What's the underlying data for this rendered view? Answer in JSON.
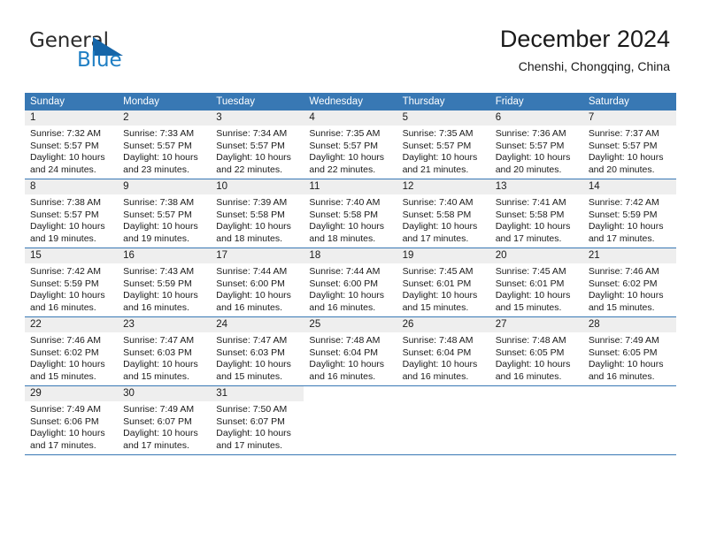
{
  "brand": {
    "name_top": "General",
    "name_bottom": "Blue",
    "accent_color": "#1f7fc4",
    "triangle_color": "#1565a8"
  },
  "header": {
    "title": "December 2024",
    "location": "Chenshi, Chongqing, China"
  },
  "calendar": {
    "header_bg": "#3878b4",
    "day_strip_bg": "#eeeeee",
    "weekdays": [
      "Sunday",
      "Monday",
      "Tuesday",
      "Wednesday",
      "Thursday",
      "Friday",
      "Saturday"
    ],
    "weeks": [
      [
        {
          "day": "1",
          "sunrise": "Sunrise: 7:32 AM",
          "sunset": "Sunset: 5:57 PM",
          "daylight_1": "Daylight: 10 hours",
          "daylight_2": "and 24 minutes."
        },
        {
          "day": "2",
          "sunrise": "Sunrise: 7:33 AM",
          "sunset": "Sunset: 5:57 PM",
          "daylight_1": "Daylight: 10 hours",
          "daylight_2": "and 23 minutes."
        },
        {
          "day": "3",
          "sunrise": "Sunrise: 7:34 AM",
          "sunset": "Sunset: 5:57 PM",
          "daylight_1": "Daylight: 10 hours",
          "daylight_2": "and 22 minutes."
        },
        {
          "day": "4",
          "sunrise": "Sunrise: 7:35 AM",
          "sunset": "Sunset: 5:57 PM",
          "daylight_1": "Daylight: 10 hours",
          "daylight_2": "and 22 minutes."
        },
        {
          "day": "5",
          "sunrise": "Sunrise: 7:35 AM",
          "sunset": "Sunset: 5:57 PM",
          "daylight_1": "Daylight: 10 hours",
          "daylight_2": "and 21 minutes."
        },
        {
          "day": "6",
          "sunrise": "Sunrise: 7:36 AM",
          "sunset": "Sunset: 5:57 PM",
          "daylight_1": "Daylight: 10 hours",
          "daylight_2": "and 20 minutes."
        },
        {
          "day": "7",
          "sunrise": "Sunrise: 7:37 AM",
          "sunset": "Sunset: 5:57 PM",
          "daylight_1": "Daylight: 10 hours",
          "daylight_2": "and 20 minutes."
        }
      ],
      [
        {
          "day": "8",
          "sunrise": "Sunrise: 7:38 AM",
          "sunset": "Sunset: 5:57 PM",
          "daylight_1": "Daylight: 10 hours",
          "daylight_2": "and 19 minutes."
        },
        {
          "day": "9",
          "sunrise": "Sunrise: 7:38 AM",
          "sunset": "Sunset: 5:57 PM",
          "daylight_1": "Daylight: 10 hours",
          "daylight_2": "and 19 minutes."
        },
        {
          "day": "10",
          "sunrise": "Sunrise: 7:39 AM",
          "sunset": "Sunset: 5:58 PM",
          "daylight_1": "Daylight: 10 hours",
          "daylight_2": "and 18 minutes."
        },
        {
          "day": "11",
          "sunrise": "Sunrise: 7:40 AM",
          "sunset": "Sunset: 5:58 PM",
          "daylight_1": "Daylight: 10 hours",
          "daylight_2": "and 18 minutes."
        },
        {
          "day": "12",
          "sunrise": "Sunrise: 7:40 AM",
          "sunset": "Sunset: 5:58 PM",
          "daylight_1": "Daylight: 10 hours",
          "daylight_2": "and 17 minutes."
        },
        {
          "day": "13",
          "sunrise": "Sunrise: 7:41 AM",
          "sunset": "Sunset: 5:58 PM",
          "daylight_1": "Daylight: 10 hours",
          "daylight_2": "and 17 minutes."
        },
        {
          "day": "14",
          "sunrise": "Sunrise: 7:42 AM",
          "sunset": "Sunset: 5:59 PM",
          "daylight_1": "Daylight: 10 hours",
          "daylight_2": "and 17 minutes."
        }
      ],
      [
        {
          "day": "15",
          "sunrise": "Sunrise: 7:42 AM",
          "sunset": "Sunset: 5:59 PM",
          "daylight_1": "Daylight: 10 hours",
          "daylight_2": "and 16 minutes."
        },
        {
          "day": "16",
          "sunrise": "Sunrise: 7:43 AM",
          "sunset": "Sunset: 5:59 PM",
          "daylight_1": "Daylight: 10 hours",
          "daylight_2": "and 16 minutes."
        },
        {
          "day": "17",
          "sunrise": "Sunrise: 7:44 AM",
          "sunset": "Sunset: 6:00 PM",
          "daylight_1": "Daylight: 10 hours",
          "daylight_2": "and 16 minutes."
        },
        {
          "day": "18",
          "sunrise": "Sunrise: 7:44 AM",
          "sunset": "Sunset: 6:00 PM",
          "daylight_1": "Daylight: 10 hours",
          "daylight_2": "and 16 minutes."
        },
        {
          "day": "19",
          "sunrise": "Sunrise: 7:45 AM",
          "sunset": "Sunset: 6:01 PM",
          "daylight_1": "Daylight: 10 hours",
          "daylight_2": "and 15 minutes."
        },
        {
          "day": "20",
          "sunrise": "Sunrise: 7:45 AM",
          "sunset": "Sunset: 6:01 PM",
          "daylight_1": "Daylight: 10 hours",
          "daylight_2": "and 15 minutes."
        },
        {
          "day": "21",
          "sunrise": "Sunrise: 7:46 AM",
          "sunset": "Sunset: 6:02 PM",
          "daylight_1": "Daylight: 10 hours",
          "daylight_2": "and 15 minutes."
        }
      ],
      [
        {
          "day": "22",
          "sunrise": "Sunrise: 7:46 AM",
          "sunset": "Sunset: 6:02 PM",
          "daylight_1": "Daylight: 10 hours",
          "daylight_2": "and 15 minutes."
        },
        {
          "day": "23",
          "sunrise": "Sunrise: 7:47 AM",
          "sunset": "Sunset: 6:03 PM",
          "daylight_1": "Daylight: 10 hours",
          "daylight_2": "and 15 minutes."
        },
        {
          "day": "24",
          "sunrise": "Sunrise: 7:47 AM",
          "sunset": "Sunset: 6:03 PM",
          "daylight_1": "Daylight: 10 hours",
          "daylight_2": "and 15 minutes."
        },
        {
          "day": "25",
          "sunrise": "Sunrise: 7:48 AM",
          "sunset": "Sunset: 6:04 PM",
          "daylight_1": "Daylight: 10 hours",
          "daylight_2": "and 16 minutes."
        },
        {
          "day": "26",
          "sunrise": "Sunrise: 7:48 AM",
          "sunset": "Sunset: 6:04 PM",
          "daylight_1": "Daylight: 10 hours",
          "daylight_2": "and 16 minutes."
        },
        {
          "day": "27",
          "sunrise": "Sunrise: 7:48 AM",
          "sunset": "Sunset: 6:05 PM",
          "daylight_1": "Daylight: 10 hours",
          "daylight_2": "and 16 minutes."
        },
        {
          "day": "28",
          "sunrise": "Sunrise: 7:49 AM",
          "sunset": "Sunset: 6:05 PM",
          "daylight_1": "Daylight: 10 hours",
          "daylight_2": "and 16 minutes."
        }
      ],
      [
        {
          "day": "29",
          "sunrise": "Sunrise: 7:49 AM",
          "sunset": "Sunset: 6:06 PM",
          "daylight_1": "Daylight: 10 hours",
          "daylight_2": "and 17 minutes."
        },
        {
          "day": "30",
          "sunrise": "Sunrise: 7:49 AM",
          "sunset": "Sunset: 6:07 PM",
          "daylight_1": "Daylight: 10 hours",
          "daylight_2": "and 17 minutes."
        },
        {
          "day": "31",
          "sunrise": "Sunrise: 7:50 AM",
          "sunset": "Sunset: 6:07 PM",
          "daylight_1": "Daylight: 10 hours",
          "daylight_2": "and 17 minutes."
        },
        {
          "day": "",
          "sunrise": "",
          "sunset": "",
          "daylight_1": "",
          "daylight_2": ""
        },
        {
          "day": "",
          "sunrise": "",
          "sunset": "",
          "daylight_1": "",
          "daylight_2": ""
        },
        {
          "day": "",
          "sunrise": "",
          "sunset": "",
          "daylight_1": "",
          "daylight_2": ""
        },
        {
          "day": "",
          "sunrise": "",
          "sunset": "",
          "daylight_1": "",
          "daylight_2": ""
        }
      ]
    ]
  }
}
